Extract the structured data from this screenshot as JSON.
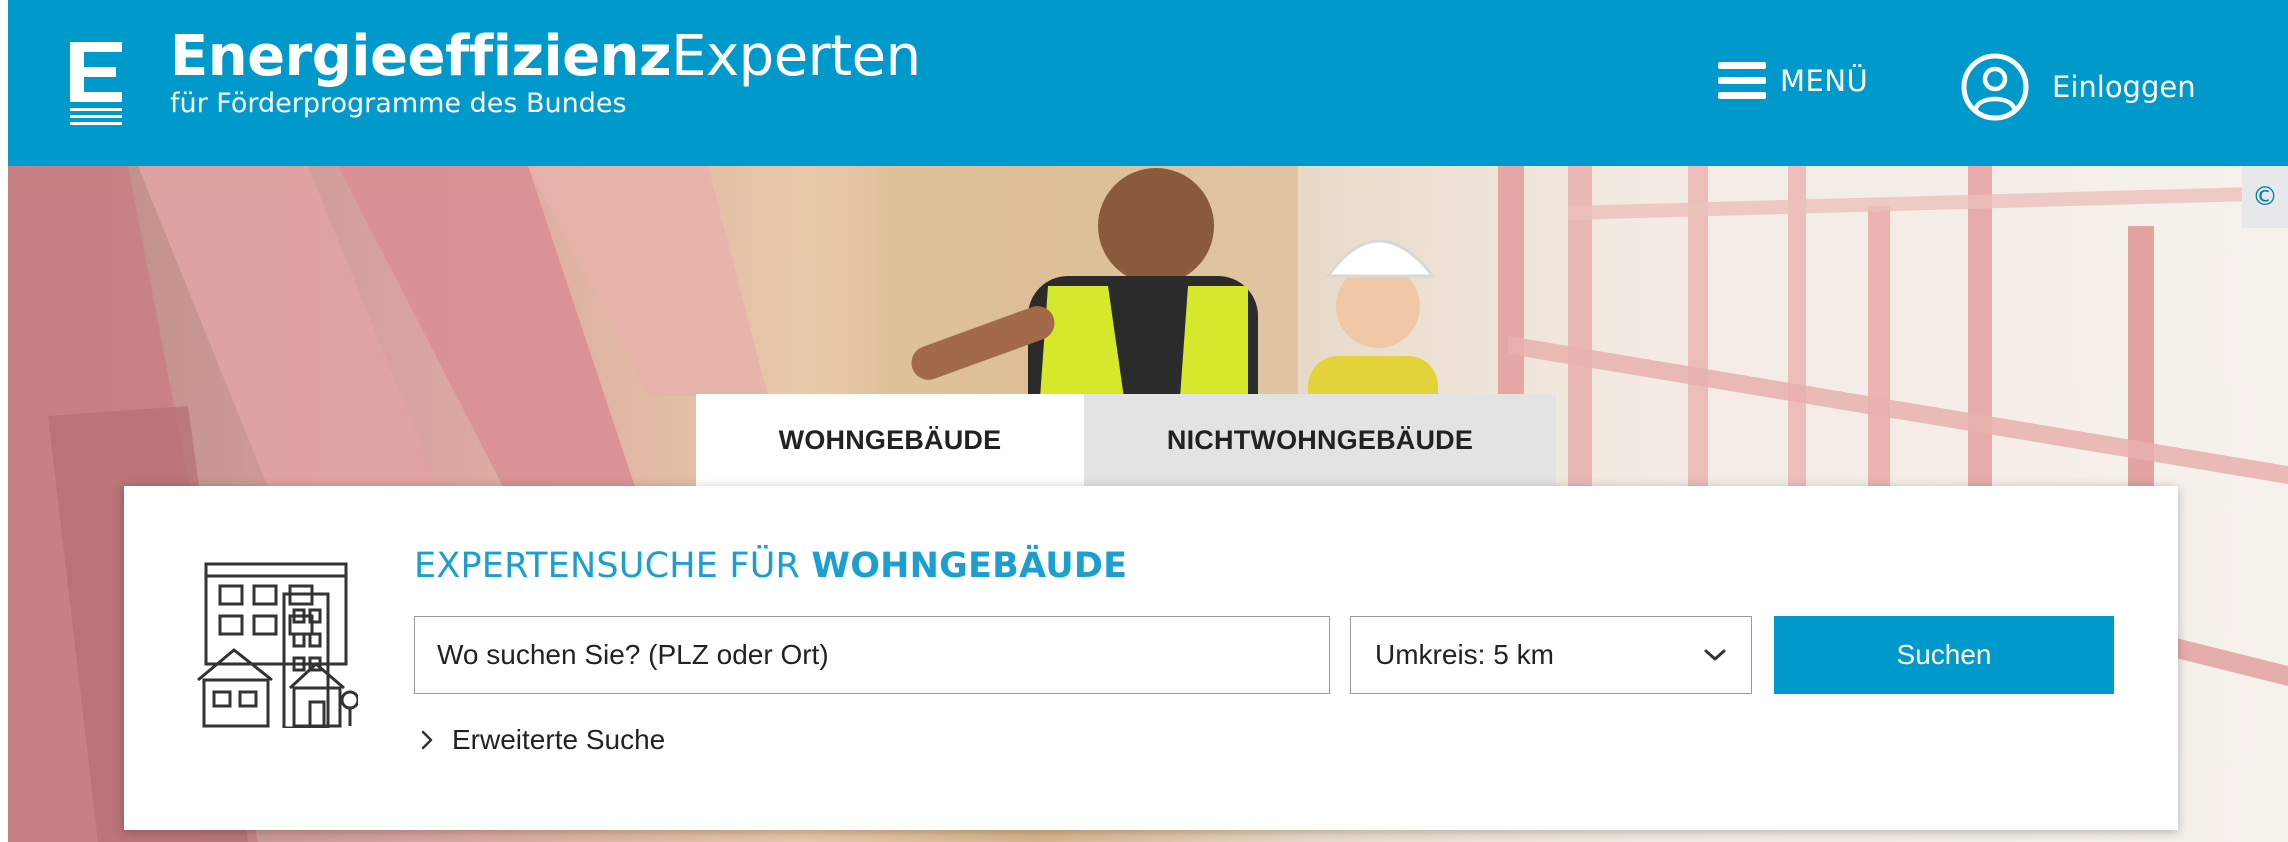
{
  "header": {
    "brand_bold": "Energieeffizienz",
    "brand_light": "Experten",
    "brand_subtitle": "für Förderprogramme des Bundes",
    "menu_label": "MENÜ",
    "login_label": "Einloggen"
  },
  "hero": {
    "copyright_symbol": "©"
  },
  "tabs": [
    {
      "label": "WOHNGEBÄUDE",
      "active": true
    },
    {
      "label": "NICHTWOHNGEBÄUDE",
      "active": false
    }
  ],
  "search": {
    "title_prefix": "EXPERTENSUCHE FÜR ",
    "title_emphasis": "WOHNGEBÄUDE",
    "location_placeholder": "Wo suchen Sie? (PLZ oder Ort)",
    "radius_selected": "Umkreis: 5 km",
    "submit_label": "Suchen",
    "advanced_label": "Erweiterte Suche"
  },
  "colors": {
    "brand_blue": "#0099cc",
    "title_blue": "#1a9fd0",
    "inactive_tab": "#e3e3e3"
  },
  "icons": [
    "logo-e-icon",
    "hamburger-icon",
    "user-circle-icon",
    "building-icon",
    "chevron-down-icon",
    "chevron-right-icon"
  ]
}
